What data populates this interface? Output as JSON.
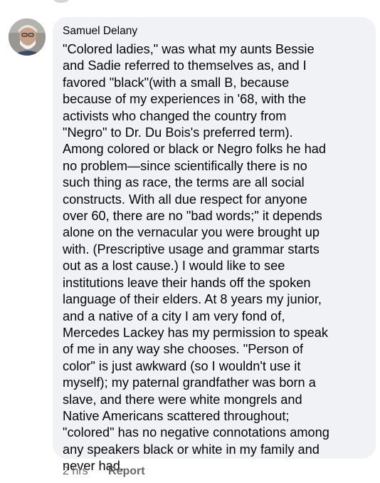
{
  "previous_comment": {
    "avatar_icon": "avatar-fragment"
  },
  "comment": {
    "author": "Samuel Delany",
    "avatar_icon": "profile-photo",
    "text": "\"Colored ladies,\" was what my aunts Bessie\nand Sadie referred to themselves as, and I\nfavored \"black\"(with a small B, because\nbecause of my experiences in '68, with the\nactivists who changed the country from\n\"Negro\" to Dr. Du Bois's preferred term).\nAmong colored or black or Negro folks he had\nno problem—since scientifically there is no\nsuch thing as race, the terms are all social\nconstructs. With all due respect for anyone\nover 60, there are no \"bad words;\" it depends\nalone on the vernacular you were brought up\nwith. (Prescriptive usage and grammar starts\nout as a lost cause.) I would like to see\ninstitutions leave their hands off the spoken\nlanguage of their elders. At 8 years my junior,\nand a native of a city I am very fond of,\nMercedes Lackey has my permission to speak\nof me in any way she chooses. \"Person of\ncolor\" is just awkward (so I wouldn't use it\nmyself); my paternal grandfather was born a\nslave, and there were white mongrels and\nNative Americans scattered throughout;\n\"colored\" has no negative connotations among\nany speakers black or white in my family and\nnever had.",
    "timestamp": "2 hrs",
    "report_label": "Report"
  },
  "colors": {
    "bubble_background": "#f0f2f5",
    "text": "#050505",
    "meta_text": "#65676b"
  }
}
